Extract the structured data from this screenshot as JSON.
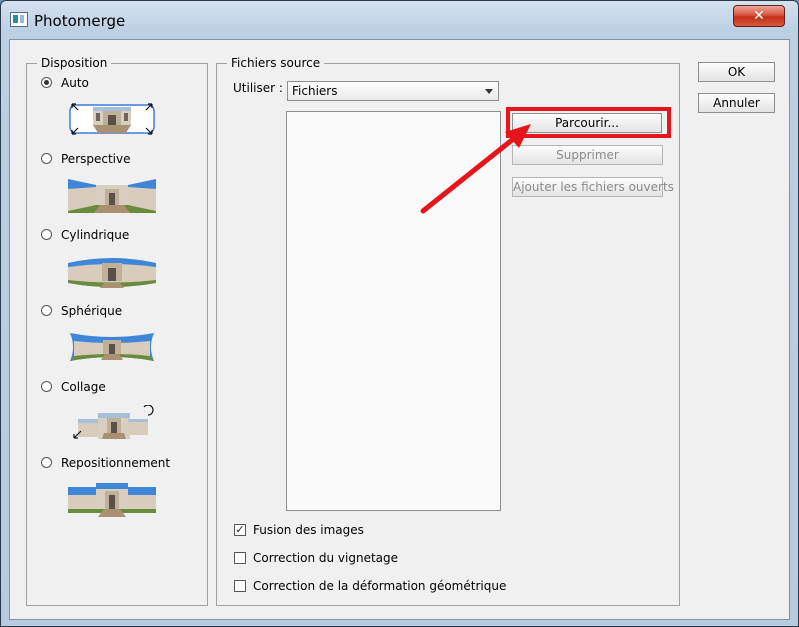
{
  "window": {
    "title": "Photomerge",
    "close_symbol": "✕"
  },
  "disposition": {
    "label": "Disposition",
    "options": [
      {
        "label": "Auto",
        "checked": true
      },
      {
        "label": "Perspective",
        "checked": false
      },
      {
        "label": "Cylindrique",
        "checked": false
      },
      {
        "label": "Sphérique",
        "checked": false
      },
      {
        "label": "Collage",
        "checked": false
      },
      {
        "label": "Repositionnement",
        "checked": false
      }
    ]
  },
  "source": {
    "label": "Fichiers source",
    "use_label": "Utiliser :",
    "use_value": "Fichiers",
    "buttons": {
      "browse": "Parcourir...",
      "remove": "Supprimer",
      "add_open": "Ajouter les fichiers ouverts"
    },
    "checkboxes": [
      {
        "label": "Fusion des images",
        "checked": true
      },
      {
        "label": "Correction du vignetage",
        "checked": false
      },
      {
        "label": "Correction de la déformation géométrique",
        "checked": false
      }
    ]
  },
  "dialog_buttons": {
    "ok": "OK",
    "cancel": "Annuler"
  },
  "colors": {
    "highlight": "#e8141c",
    "sky": "#3f86d9",
    "grass": "#6a8a3c"
  }
}
